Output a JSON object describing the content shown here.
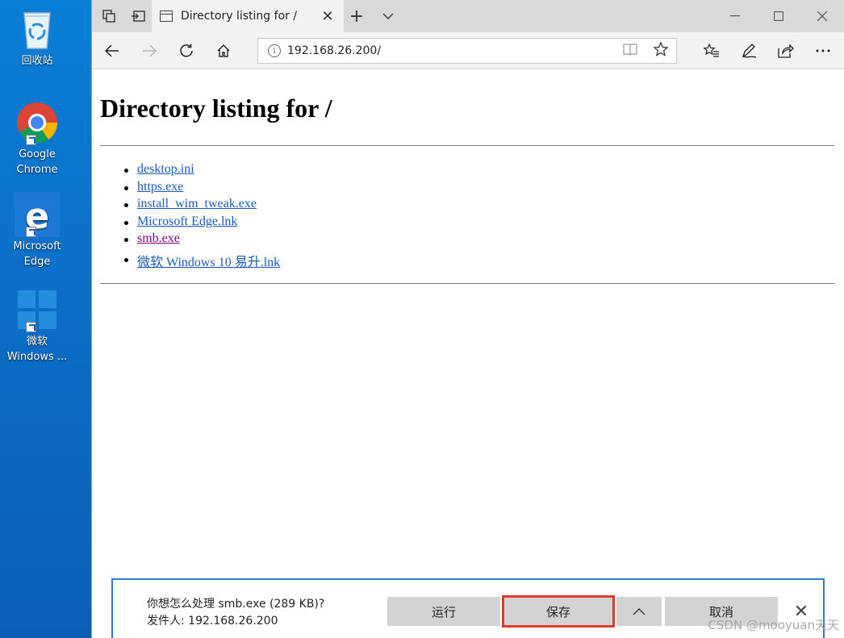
{
  "desktop": {
    "icons": [
      {
        "label": "回收站"
      },
      {
        "label": "Google Chrome"
      },
      {
        "label": "Microsoft Edge"
      },
      {
        "label": "微软 Windows ..."
      }
    ]
  },
  "browser": {
    "tab": {
      "title": "Directory listing for /"
    },
    "address": {
      "url": "192.168.26.200/"
    }
  },
  "page": {
    "heading": "Directory listing for /",
    "files": [
      {
        "name": "desktop.ini",
        "visited": false
      },
      {
        "name": "https.exe",
        "visited": false
      },
      {
        "name": "install_wim_tweak.exe",
        "visited": false
      },
      {
        "name": "Microsoft Edge.lnk",
        "visited": false
      },
      {
        "name": "smb.exe",
        "visited": true
      },
      {
        "name": "微软 Windows 10 易升.lnk",
        "visited": false
      }
    ]
  },
  "download": {
    "question": "你想怎么处理 smb.exe (289 KB)?",
    "publisher": "发件人: 192.168.26.200",
    "run_label": "运行",
    "save_label": "保存",
    "cancel_label": "取消"
  },
  "watermark": "CSDN @mooyuan天天",
  "colors": {
    "link": "#1a59b8",
    "visited": "#800080",
    "highlight": "#e03a2e",
    "accent": "#2b7cd3"
  }
}
